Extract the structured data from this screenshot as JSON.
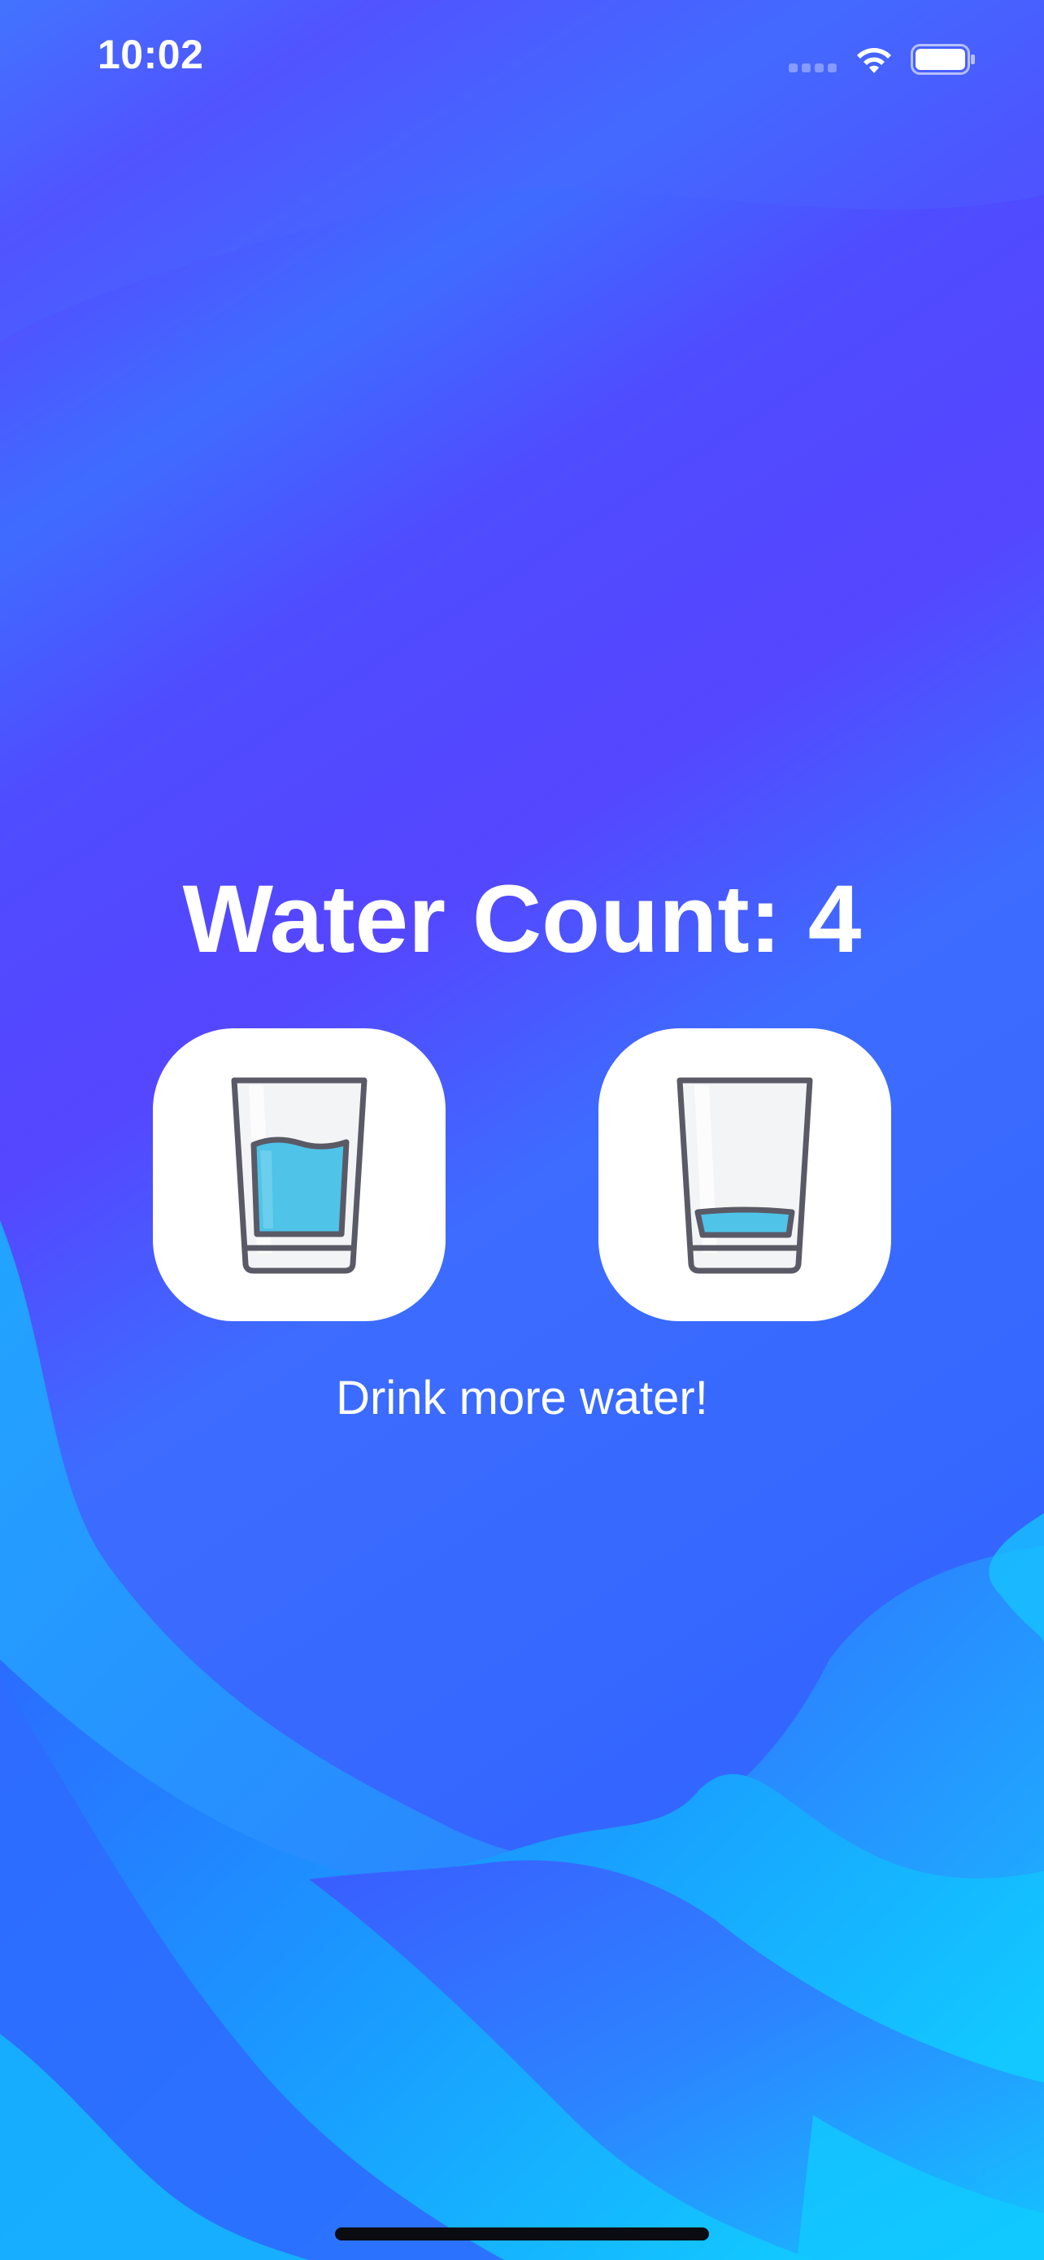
{
  "status_bar": {
    "time": "10:02",
    "cellular_icon": "cellular-signal-icon",
    "wifi_icon": "wifi-icon",
    "battery_icon": "battery-icon"
  },
  "main": {
    "title": "Water Count: 4",
    "buttons": [
      {
        "name": "full-glass-button",
        "icon": "full-water-glass-icon"
      },
      {
        "name": "empty-glass-button",
        "icon": "nearly-empty-water-glass-icon"
      }
    ],
    "message": "Drink more water!"
  },
  "colors": {
    "background_top": "#4a4dff",
    "background_mid": "#5546ff",
    "wave_light": "#14c8ff",
    "wave_mid": "#2a8cff",
    "water": "#4fc3e8",
    "glass_outline": "#5a5a66",
    "tile": "#ffffff"
  }
}
